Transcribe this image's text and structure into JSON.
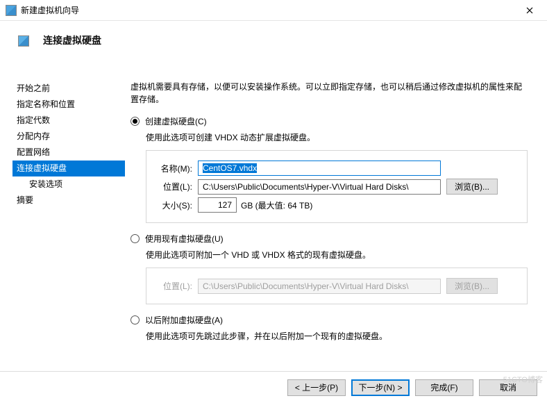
{
  "titlebar": {
    "title": "新建虚拟机向导"
  },
  "header": {
    "title": "连接虚拟硬盘"
  },
  "sidebar": {
    "steps": [
      {
        "label": "开始之前",
        "active": false
      },
      {
        "label": "指定名称和位置",
        "active": false
      },
      {
        "label": "指定代数",
        "active": false
      },
      {
        "label": "分配内存",
        "active": false
      },
      {
        "label": "配置网络",
        "active": false
      },
      {
        "label": "连接虚拟硬盘",
        "active": true
      },
      {
        "label": "安装选项",
        "active": false,
        "indent": true
      },
      {
        "label": "摘要",
        "active": false
      }
    ]
  },
  "intro": "虚拟机需要具有存储，以便可以安装操作系统。可以立即指定存储，也可以稍后通过修改虚拟机的属性来配置存储。",
  "opt_create": {
    "label": "创建虚拟硬盘(C)",
    "desc": "使用此选项可创建 VHDX 动态扩展虚拟硬盘。",
    "name_label": "名称(M):",
    "name_value": "CentOS7.vhdx",
    "loc_label": "位置(L):",
    "loc_value": "C:\\Users\\Public\\Documents\\Hyper-V\\Virtual Hard Disks\\",
    "browse_label": "浏览(B)...",
    "size_label": "大小(S):",
    "size_value": "127",
    "size_unit": "GB (最大值: 64 TB)"
  },
  "opt_existing": {
    "label": "使用现有虚拟硬盘(U)",
    "desc": "使用此选项可附加一个 VHD 或 VHDX 格式的现有虚拟硬盘。",
    "loc_label": "位置(L):",
    "loc_value": "C:\\Users\\Public\\Documents\\Hyper-V\\Virtual Hard Disks\\",
    "browse_label": "浏览(B)..."
  },
  "opt_later": {
    "label": "以后附加虚拟硬盘(A)",
    "desc": "使用此选项可先跳过此步骤，并在以后附加一个现有的虚拟硬盘。"
  },
  "footer": {
    "prev": "< 上一步(P)",
    "next": "下一步(N) >",
    "finish": "完成(F)",
    "cancel": "取消"
  },
  "watermark": "51CTO博客"
}
